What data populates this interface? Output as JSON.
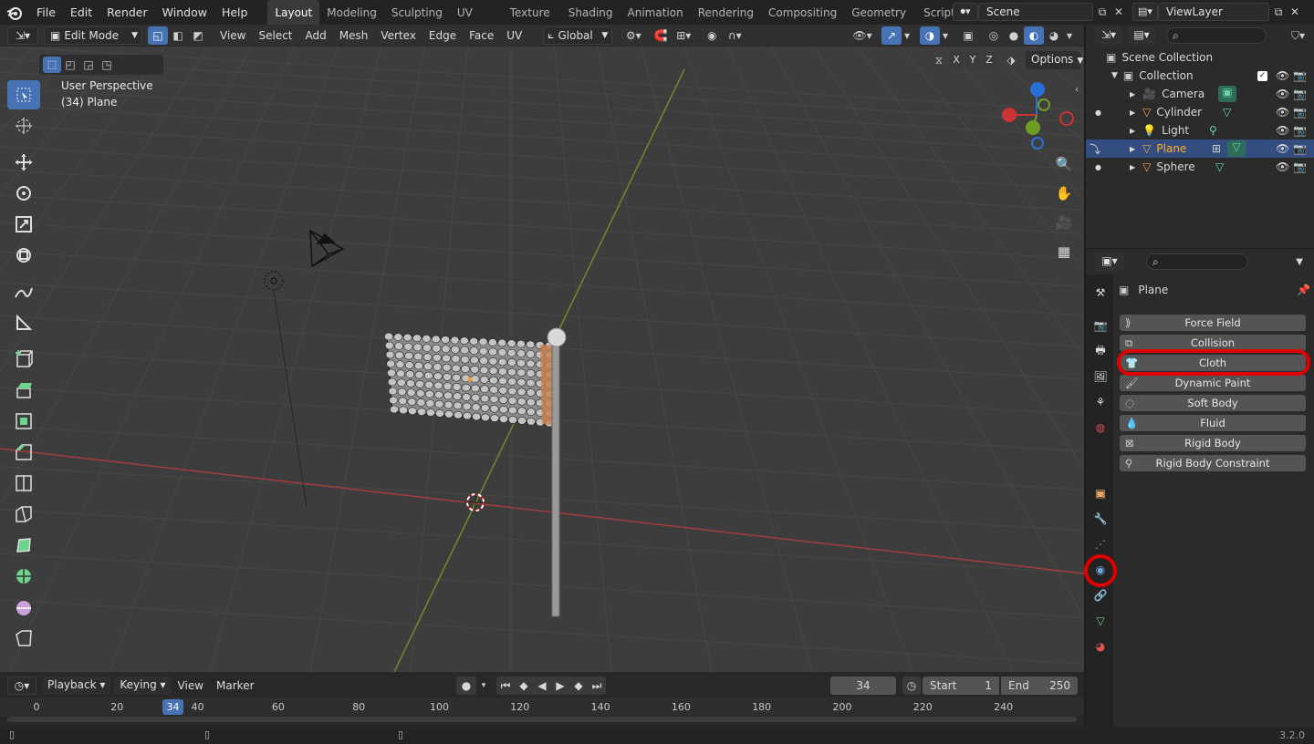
{
  "app": {
    "version": "3.2.0"
  },
  "menubar": {
    "file": "File",
    "edit": "Edit",
    "render": "Render",
    "window": "Window",
    "help": "Help"
  },
  "workspaces": [
    "Layout",
    "Modeling",
    "Sculpting",
    "UV Editing",
    "Texture Paint",
    "Shading",
    "Animation",
    "Rendering",
    "Compositing",
    "Geometry Nodes",
    "Scripting"
  ],
  "scene": {
    "name": "Scene",
    "view_layer": "ViewLayer"
  },
  "header": {
    "mode": "Edit Mode",
    "view": "View",
    "select": "Select",
    "add": "Add",
    "mesh": "Mesh",
    "vertex": "Vertex",
    "edge": "Edge",
    "face": "Face",
    "uv": "UV",
    "orientation": "Global",
    "options": "Options",
    "x": "X",
    "y": "Y",
    "z": "Z"
  },
  "viewport": {
    "perspective": "User Perspective",
    "object_info": "(34) Plane"
  },
  "gizmo": {
    "x": "X",
    "y": "Y",
    "z": "Z"
  },
  "outliner": {
    "scene_collection": "Scene Collection",
    "collection": "Collection",
    "items": [
      {
        "name": "Camera"
      },
      {
        "name": "Cylinder"
      },
      {
        "name": "Light"
      },
      {
        "name": "Plane"
      },
      {
        "name": "Sphere"
      }
    ]
  },
  "properties": {
    "object_name": "Plane",
    "physics_buttons": [
      "Force Field",
      "Collision",
      "Cloth",
      "Dynamic Paint",
      "Soft Body",
      "Fluid",
      "Rigid Body",
      "Rigid Body Constraint"
    ]
  },
  "timeline": {
    "playback": "Playback",
    "keying": "Keying",
    "view": "View",
    "marker": "Marker",
    "current_frame": "34",
    "start_label": "Start",
    "start": "1",
    "end_label": "End",
    "end": "250",
    "ticks": [
      "0",
      "20",
      "40",
      "60",
      "80",
      "100",
      "120",
      "140",
      "160",
      "180",
      "200",
      "220",
      "240"
    ]
  },
  "colors": {
    "accent": "#4772b3",
    "highlight_red": "#e00000",
    "selected_object": "#ffaf29",
    "x_axis": "#cc3333",
    "y_axis": "#6e9c26",
    "z_axis": "#2a6fd6"
  }
}
